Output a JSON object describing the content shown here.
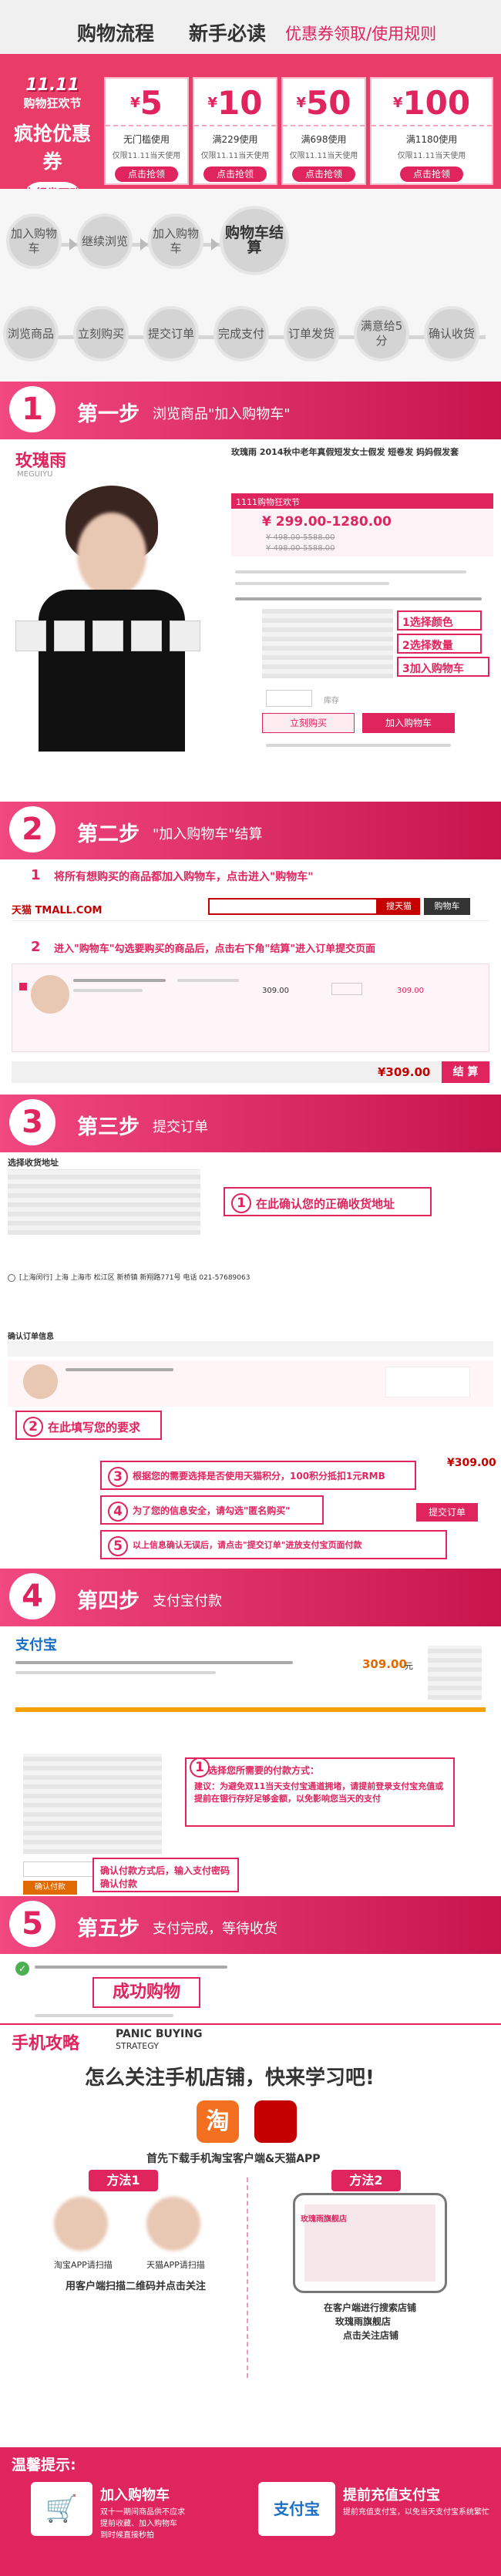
{
  "header": {
    "title1": "购物流程",
    "title2": "新手必读",
    "title3": "优惠券领取/使用规则"
  },
  "promo": {
    "logo_line1": "11.11",
    "logo_line2": "购物狂欢节",
    "tagline": "疯抢优惠券",
    "claim_first": "先领券再购物"
  },
  "coupons": [
    {
      "amount": "5",
      "condition": "无门槛使用",
      "date": "仅限11.11当天使用",
      "button": "点击抢领"
    },
    {
      "amount": "10",
      "condition": "满229使用",
      "date": "仅限11.11当天使用",
      "button": "点击抢领"
    },
    {
      "amount": "50",
      "condition": "满698使用",
      "date": "仅限11.11当天使用",
      "button": "点击抢领"
    },
    {
      "amount": "100",
      "condition": "满1180使用",
      "date": "仅限11.11当天使用",
      "button": "点击抢领"
    }
  ],
  "flow": {
    "row1": [
      "加入购物车",
      "继续浏览",
      "加入购物车",
      "购物车结算"
    ],
    "row2": [
      "浏览商品",
      "立刻购买",
      "提交订单",
      "完成支付",
      "订单发货",
      "满意给5分",
      "确认收货"
    ]
  },
  "step1": {
    "num": "1",
    "label": "第一步",
    "desc": "浏览商品\"加入购物车\"",
    "brand": "玫瑰雨",
    "brand_en": "MEGUIYU",
    "product_title": "玫瑰雨 2014秋中老年真假短发女士假发 短卷发 妈妈假发套",
    "price": "¥ 299.00-1280.00",
    "old_price1": "¥ 498.00-5588.00",
    "old_price2": "¥ 498.00-5588.00",
    "activity": "1111购物狂欢节",
    "callout1": "1选择颜色",
    "callout2": "2选择数量",
    "callout3": "3加入购物车",
    "buy_now": "立刻购买",
    "add_cart": "加入购物车",
    "stock_label": "库存"
  },
  "step2": {
    "num": "2",
    "label": "第二步",
    "desc": "\"加入购物车\"结算",
    "inst1_num": "1",
    "inst1": "将所有想购买的商品都加入购物车，点击进入\"购物车\"",
    "inst2_num": "2",
    "inst2": "进入\"购物车\"勾选要购买的商品后，点击右下角\"结算\"进入订单提交页面",
    "tmall": "天猫 TMALL.COM",
    "search_btn": "搜天猫",
    "cart_btn": "购物车",
    "total": "¥309.00",
    "settle": "结 算",
    "item_price": "309.00"
  },
  "step3": {
    "num": "3",
    "label": "第三步",
    "desc": "提交订单",
    "section_title": "选择收货地址",
    "address": "[上海闵行] 上海 上海市 松江区 新桥镇 新翔路771号 电话 021-57689063",
    "callout1_num": "1",
    "callout1": "在此确认您的正确收货地址",
    "callout2_num": "2",
    "callout2": "在此填写您的要求",
    "callout3_num": "3",
    "callout3": "根据您的需要选择是否使用天猫积分，100积分抵扣1元RMB",
    "callout4_num": "4",
    "callout4": "为了您的信息安全，请勾选\"匿名购买\"",
    "callout5_num": "5",
    "callout5": "以上信息确认无误后，请点击\"提交订单\"进放支付宝页面付款",
    "total": "¥309.00",
    "submit": "提交订单",
    "confirm_title": "确认订单信息"
  },
  "step4": {
    "num": "4",
    "label": "第四步",
    "desc": "支付宝付款",
    "alipay": "支付宝",
    "amount": "309.00",
    "unit": "元",
    "callout1_num": "1",
    "callout1": "选择您所需要的付款方式：",
    "callout1b": "建议：为避免双11当天支付宝通道拥堵，请提前登录支付宝充值或提前在银行存好足够金额，以免影响您当天的支付",
    "confirm_pay": "确认付款",
    "callout2": "确认付款方式后，输入支付密码确认付款"
  },
  "step5": {
    "num": "5",
    "label": "第五步",
    "desc": "支付完成，等待收货",
    "success": "成功购物"
  },
  "mobile": {
    "title": "手机攻略",
    "en1": "PANIC BUYING",
    "en2": "STRATEGY",
    "headline": "怎么关注手机店铺，快来学习吧!",
    "taobao_icon": "淘",
    "sub": "首先下载手机淘宝客户端&天猫APP",
    "method1": "方法1",
    "method2": "方法2",
    "m1_cap1": "淘宝APP请扫描",
    "m1_cap2": "天猫APP请扫描",
    "m1_bottom": "用客户端扫描二维码并点击关注",
    "m2_cap1": "在客户端进行搜索店铺",
    "m2_cap2": "玫瑰雨旗舰店",
    "m2_cap3": "点击关注店铺",
    "app_store": "玫瑰雨旗舰店"
  },
  "tips": {
    "title": "温馨提示:",
    "left_title": "加入购物车",
    "left_desc": "双十一期间商品供不应求\n提前收藏、加入购物车\n到时候直接秒拍",
    "right_title": "提前充值支付宝",
    "right_desc": "提前充值支付宝，以免当天支付宝系统繁忙"
  }
}
